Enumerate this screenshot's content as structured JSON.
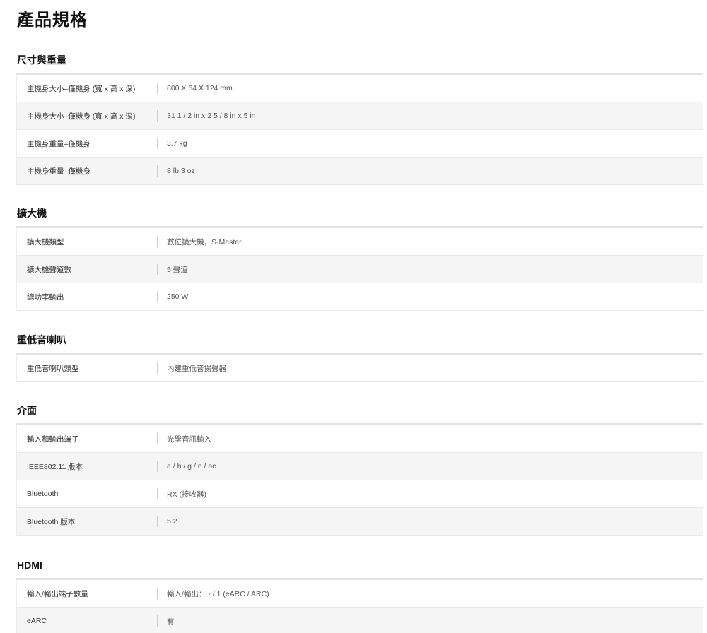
{
  "page": {
    "title": "產品規格"
  },
  "sections": [
    {
      "title": "尺寸與重量",
      "rows": [
        {
          "label": "主機身大小–僅機身 (寬 x 高 x 深)",
          "value": "800 X 64 X 124 mm"
        },
        {
          "label": "主機身大小–僅機身 (寬 x 高 x 深)",
          "value": "31 1 / 2 in x 2 5 / 8 in x 5 in"
        },
        {
          "label": "主機身重量–僅機身",
          "value": "3.7 kg"
        },
        {
          "label": "主機身重量–僅機身",
          "value": "8 lb 3 oz"
        }
      ]
    },
    {
      "title": "擴大機",
      "rows": [
        {
          "label": "擴大機類型",
          "value": "數位擴大機，S-Master"
        },
        {
          "label": "擴大機聲道數",
          "value": "5 聲道"
        },
        {
          "label": "總功率輸出",
          "value": "250 W"
        }
      ]
    },
    {
      "title": "重低音喇叭",
      "rows": [
        {
          "label": "重低音喇叭類型",
          "value": "內建重低音揚聲器"
        }
      ]
    },
    {
      "title": "介面",
      "rows": [
        {
          "label": "輸入和輸出端子",
          "value": "光學音訊輸入"
        },
        {
          "label": "IEEE802.11 版本",
          "value": "a / b / g / n / ac"
        },
        {
          "label": "Bluetooth",
          "value": "RX (接收器)"
        },
        {
          "label": "Bluetooth 版本",
          "value": "5.2"
        }
      ]
    },
    {
      "title": "HDMI",
      "rows": [
        {
          "label": "輸入/輸出端子數量",
          "value": "輸入/輸出： - / 1 (eARC / ARC)"
        },
        {
          "label": "eARC",
          "value": "有"
        }
      ]
    }
  ]
}
